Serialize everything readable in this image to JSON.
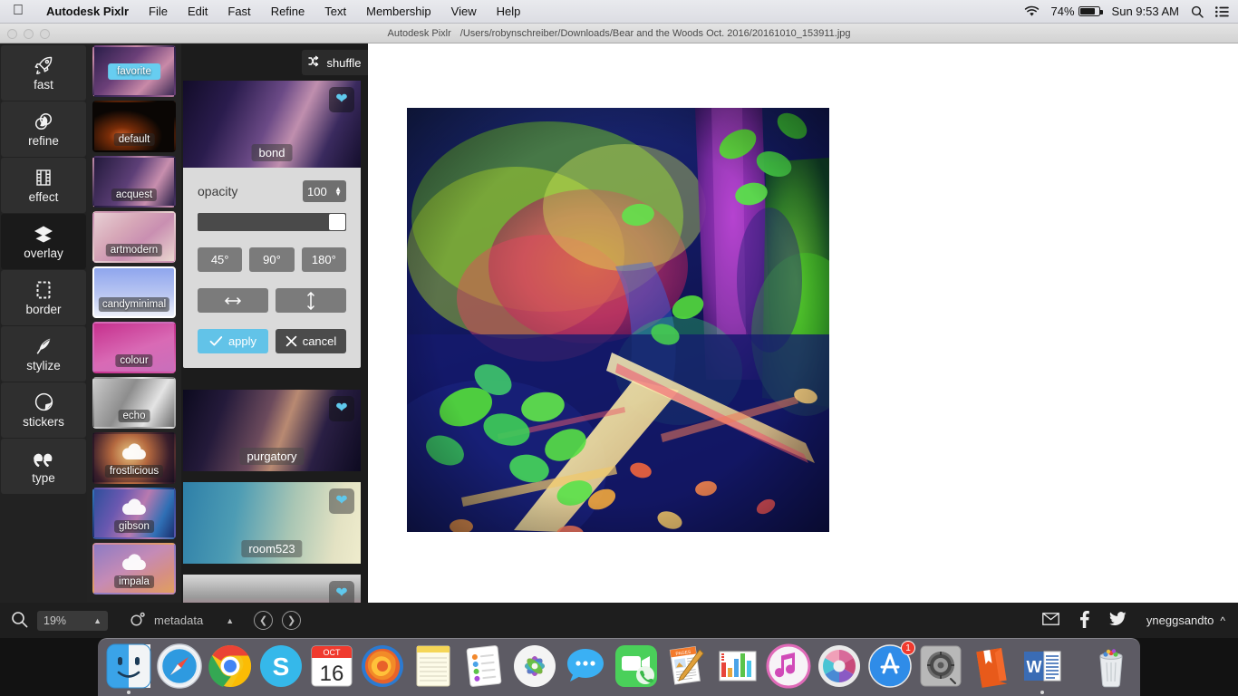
{
  "menubar": {
    "apple_icon": "apple-logo",
    "app_name": "Autodesk Pixlr",
    "items": [
      "File",
      "Edit",
      "Fast",
      "Refine",
      "Text",
      "Membership",
      "View",
      "Help"
    ],
    "wifi_icon": "wifi-icon",
    "battery_percent": "74%",
    "clock": "Sun 9:53 AM",
    "search_icon": "spotlight-search-icon",
    "notifications_icon": "notification-center-icon"
  },
  "titlebar": {
    "app_name": "Autodesk Pixlr",
    "file_path": "/Users/robynschreiber/Downloads/Bear and the Woods Oct. 2016/20161010_153911.jpg"
  },
  "toolrail": {
    "items": [
      {
        "label": "fast",
        "icon": "rocket-icon",
        "active": false
      },
      {
        "label": "refine",
        "icon": "overlapping-circles-icon",
        "active": false
      },
      {
        "label": "effect",
        "icon": "film-strip-icon",
        "active": false
      },
      {
        "label": "overlay",
        "icon": "layers-diamond-icon",
        "active": true
      },
      {
        "label": "border",
        "icon": "frame-icon",
        "active": false
      },
      {
        "label": "stylize",
        "icon": "feather-icon",
        "active": false
      },
      {
        "label": "stickers",
        "icon": "sticker-icon",
        "active": false
      },
      {
        "label": "type",
        "icon": "quotation-marks-icon",
        "active": false
      }
    ]
  },
  "thumbcol": {
    "items": [
      {
        "label": "favorite",
        "selected": false,
        "highlighted": true,
        "downloadable": false
      },
      {
        "label": "default",
        "selected": false,
        "highlighted": false,
        "downloadable": false
      },
      {
        "label": "acquest",
        "selected": false,
        "highlighted": false,
        "downloadable": false
      },
      {
        "label": "artmodern",
        "selected": false,
        "highlighted": false,
        "downloadable": false
      },
      {
        "label": "candyminimal",
        "selected": true,
        "highlighted": false,
        "downloadable": false
      },
      {
        "label": "colour",
        "selected": false,
        "highlighted": false,
        "downloadable": false
      },
      {
        "label": "echo",
        "selected": false,
        "highlighted": false,
        "downloadable": false
      },
      {
        "label": "frostlicious",
        "selected": false,
        "highlighted": false,
        "downloadable": true
      },
      {
        "label": "gibson",
        "selected": false,
        "highlighted": false,
        "downloadable": true
      },
      {
        "label": "impala",
        "selected": false,
        "highlighted": false,
        "downloadable": true
      }
    ]
  },
  "overlay_panel": {
    "shuffle_label": "shuffle",
    "shuffle_icon": "shuffle-icon",
    "selected_overlay": "bond",
    "opacity_label": "opacity",
    "opacity_value": "100",
    "slider_percent": 100,
    "rotate_buttons": [
      "45°",
      "90°",
      "180°"
    ],
    "flip_horizontal_icon": "flip-horizontal-icon",
    "flip_vertical_icon": "flip-vertical-icon",
    "apply_label": "apply",
    "apply_icon": "check-icon",
    "cancel_label": "cancel",
    "cancel_icon": "x-icon",
    "heart_icon": "heart-icon",
    "more_overlays": [
      {
        "label": "purgatory"
      },
      {
        "label": "room523"
      },
      {
        "label": ""
      }
    ]
  },
  "statusbar": {
    "search_icon": "magnifier-icon",
    "zoom_value": "19%",
    "zoom_caret": "▲",
    "metadata_icon": "aperture-icon",
    "metadata_label": "metadata",
    "metadata_caret": "▲",
    "prev_icon": "chevron-left-icon",
    "next_icon": "chevron-right-icon",
    "mail_icon": "envelope-icon",
    "facebook_icon": "facebook-icon",
    "twitter_icon": "twitter-icon",
    "account_name": "yneggsandto",
    "account_caret": "^"
  },
  "dock": {
    "items": [
      {
        "name": "finder",
        "running": true
      },
      {
        "name": "safari",
        "running": false
      },
      {
        "name": "chrome",
        "running": false
      },
      {
        "name": "skype",
        "running": false
      },
      {
        "name": "calendar",
        "running": false,
        "month": "OCT",
        "day": "16"
      },
      {
        "name": "firefox",
        "running": true
      },
      {
        "name": "notes",
        "running": false
      },
      {
        "name": "reminders",
        "running": false
      },
      {
        "name": "photos",
        "running": false
      },
      {
        "name": "messages",
        "running": false
      },
      {
        "name": "facetime",
        "running": false
      },
      {
        "name": "pages",
        "running": false
      },
      {
        "name": "numbers",
        "running": false
      },
      {
        "name": "itunes",
        "running": false
      },
      {
        "name": "pixlr",
        "running": true
      },
      {
        "name": "app-store",
        "running": false,
        "badge": "1"
      },
      {
        "name": "system-preferences",
        "running": false
      },
      {
        "name": "ibooks",
        "running": false
      },
      {
        "name": "microsoft-word",
        "running": true
      },
      {
        "name": "trash",
        "running": false
      }
    ]
  },
  "colors": {
    "accent": "#62c3e8",
    "rail_bg": "#222222",
    "panel_bg": "#dadada",
    "badge_red": "#f03a2e"
  }
}
